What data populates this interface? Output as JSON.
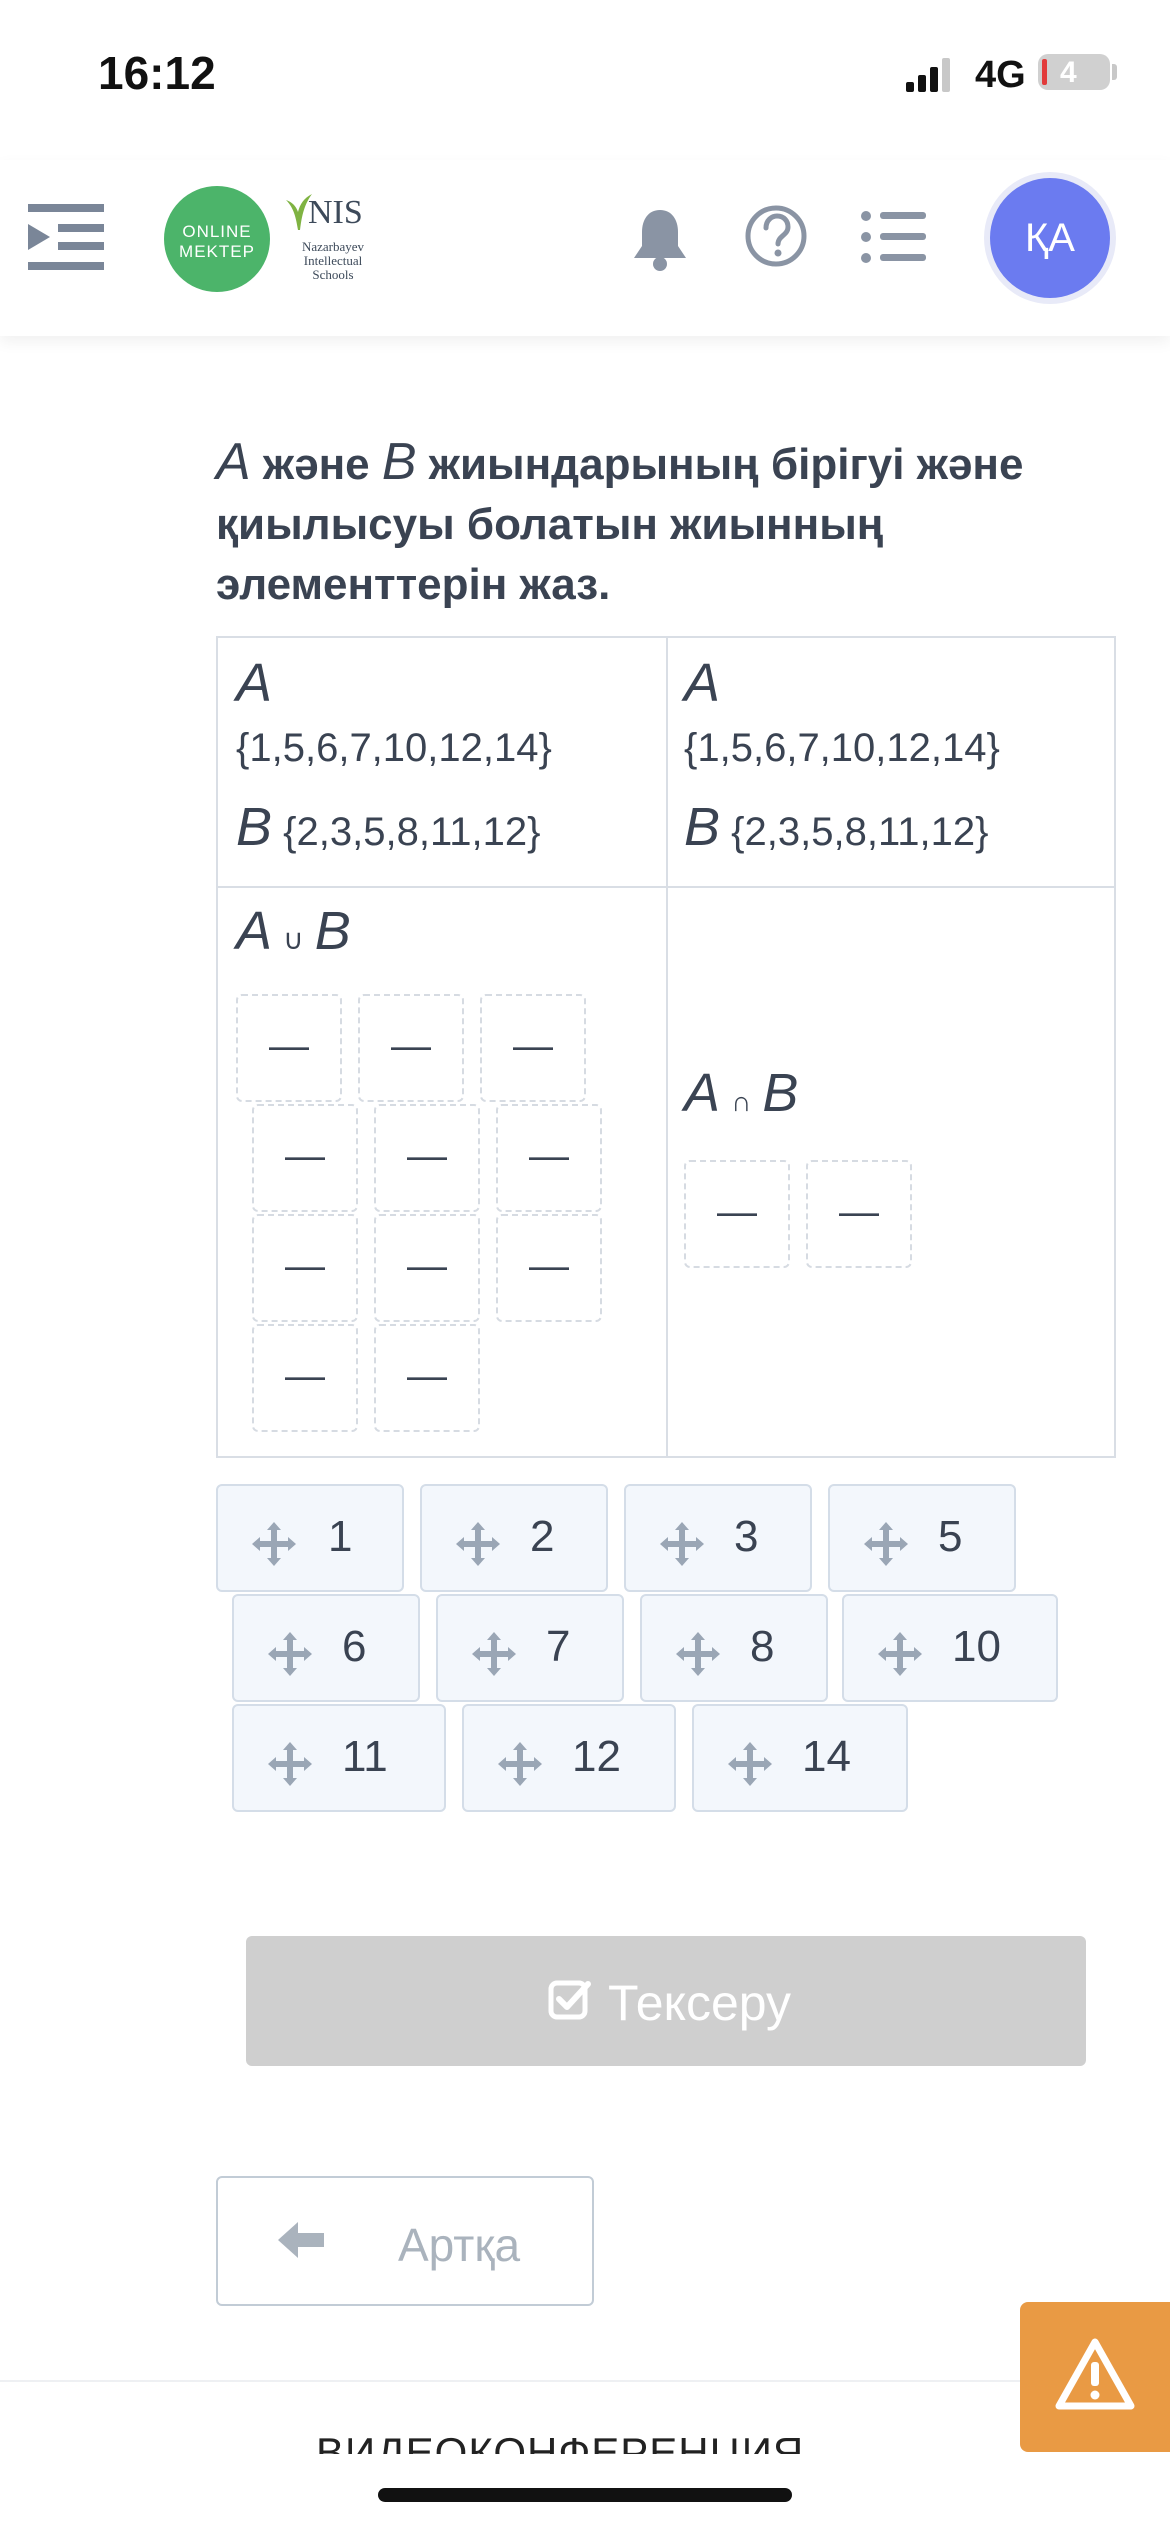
{
  "status_bar": {
    "time": "16:12",
    "network": "4G",
    "battery": "4"
  },
  "header": {
    "logo_online_line1": "ONLINE",
    "logo_online_line2": "MEKTEP",
    "logo_nis": "NIS",
    "logo_nis_sub": "Nazarbayev Intellectual Schools",
    "avatar_initials": "ҚА"
  },
  "question": {
    "set_a": "A",
    "conj1": " және ",
    "set_b": "B",
    "rest": " жиындарының бірігуі және қиылысуы болатын жиынның элементтерін жаз."
  },
  "table": {
    "left_header": {
      "a_label": "A",
      "a_elements": "{1,5,6,7,10,12,14}",
      "b_label": "B",
      "b_elements": "{2,3,5,8,11,12}"
    },
    "right_header": {
      "a_label": "A",
      "a_elements": "{1,5,6,7,10,12,14}",
      "b_label": "B",
      "b_elements": "{2,3,5,8,11,12}"
    },
    "union": {
      "a": "A",
      "op": "∪",
      "b": "B",
      "slots": [
        "—",
        "—",
        "—",
        "—",
        "—",
        "—",
        "—",
        "—",
        "—",
        "—",
        "—"
      ]
    },
    "intersection": {
      "a": "A",
      "op": "∩",
      "b": "B",
      "slots": [
        "—",
        "—"
      ]
    }
  },
  "chips": [
    "1",
    "2",
    "3",
    "5",
    "6",
    "7",
    "8",
    "10",
    "11",
    "12",
    "14"
  ],
  "buttons": {
    "check": "Тексеру",
    "back": "Артқа"
  },
  "footer": {
    "video": "ВИДЕОКОНФЕРЕНЦИЯ"
  },
  "colors": {
    "accent_avatar": "#6b7bf0",
    "online_green": "#4cb46a",
    "warning": "#e99a44",
    "chip_bg": "#f3f7fc"
  }
}
